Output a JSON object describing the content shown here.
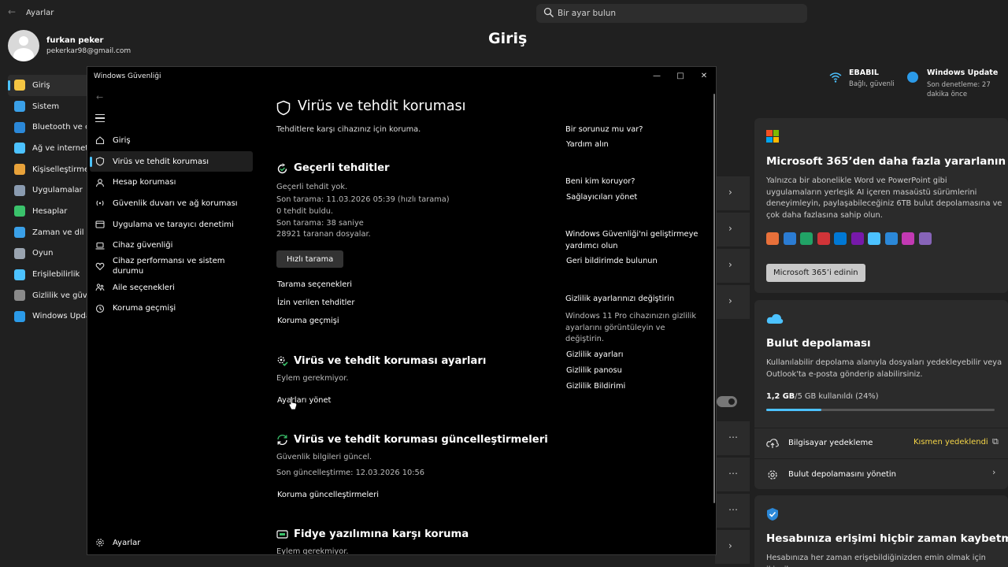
{
  "settings": {
    "app_title": "Ayarlar",
    "search_placeholder": "Bir ayar bulun",
    "user": {
      "name": "furkan peker",
      "email": "pekerkar98@gmail.com"
    },
    "page_title": "Giriş",
    "nav": [
      {
        "label": "Giriş",
        "icon": "home-icon",
        "color": "#f5c542"
      },
      {
        "label": "Sistem",
        "icon": "monitor-icon",
        "color": "#3aa0e8"
      },
      {
        "label": "Bluetooth ve cihazlar",
        "icon": "bluetooth-icon",
        "color": "#2b88d8"
      },
      {
        "label": "Ağ ve internet",
        "icon": "wifi-icon",
        "color": "#4cc2ff"
      },
      {
        "label": "Kişiselleştirme",
        "icon": "brush-icon",
        "color": "#e8a23a"
      },
      {
        "label": "Uygulamalar",
        "icon": "apps-icon",
        "color": "#8a9bb0"
      },
      {
        "label": "Hesaplar",
        "icon": "person-icon",
        "color": "#3ac26b"
      },
      {
        "label": "Zaman ve dil",
        "icon": "globe-clock-icon",
        "color": "#3aa0e8"
      },
      {
        "label": "Oyun",
        "icon": "gamepad-icon",
        "color": "#9aa4b0"
      },
      {
        "label": "Erişilebilirlik",
        "icon": "accessibility-icon",
        "color": "#4cc2ff"
      },
      {
        "label": "Gizlilik ve güvenlik",
        "icon": "shield-icon",
        "color": "#8a8a8a"
      },
      {
        "label": "Windows Update",
        "icon": "update-icon",
        "color": "#2b9ae8"
      }
    ],
    "status": {
      "wifi_title": "EBABIL",
      "wifi_sub": "Bağlı, güvenli",
      "wu_title": "Windows Update",
      "wu_sub": "Son denetleme: 27 dakika önce"
    },
    "cards": {
      "ms365": {
        "title": "Microsoft 365’den daha fazla yararlanın",
        "text": "Yalnızca bir abonelikle Word ve PowerPoint gibi uygulamaların yerleşik AI içeren masaüstü sürümlerini deneyimleyin, paylaşabileceğiniz 6TB bulut depolamasına ve çok daha fazlasına sahip olun.",
        "button": "Microsoft 365’i edinin",
        "app_colors": [
          "#e8703a",
          "#2b7cd3",
          "#21a366",
          "#d13438",
          "#0078d4",
          "#7719aa",
          "#4cc2ff",
          "#2b88d8",
          "#c239b3",
          "#8764b8"
        ]
      },
      "cloud": {
        "title": "Bulut depolaması",
        "text": "Kullanılabilir depolama alanıyla dosyaları yedekleyebilir veya Outlook'ta e-posta gönderip alabilirsiniz.",
        "usage_strong": "1,2 GB",
        "usage_rest": "/5 GB kullanıldı (24%)",
        "usage_fraction": 0.24,
        "backup_label": "Bilgisayar yedekleme",
        "backup_status": "Kısmen yedeklendi",
        "manage_label": "Bulut depolamasını yönetin"
      },
      "account": {
        "title": "Hesabınıza erişimi hiçbir zaman kaybetmeyin",
        "text": "Hesabınıza her zaman erişebildiğinizden emin olmak için ikincil"
      }
    }
  },
  "security": {
    "window_title": "Windows Güvenliği",
    "nav": [
      {
        "label": "Giriş",
        "icon": "home-icon"
      },
      {
        "label": "Virüs ve tehdit koruması",
        "icon": "shield-icon",
        "active": true
      },
      {
        "label": "Hesap koruması",
        "icon": "person-icon"
      },
      {
        "label": "Güvenlik duvarı ve ağ koruması",
        "icon": "antenna-icon"
      },
      {
        "label": "Uygulama ve tarayıcı denetimi",
        "icon": "browser-icon"
      },
      {
        "label": "Cihaz güvenliği",
        "icon": "laptop-icon"
      },
      {
        "label": "Cihaz performansı ve sistem durumu",
        "icon": "heart-icon"
      },
      {
        "label": "Aile seçenekleri",
        "icon": "family-icon"
      },
      {
        "label": "Koruma geçmişi",
        "icon": "history-icon"
      }
    ],
    "settings_label": "Ayarlar",
    "page_title": "Virüs ve tehdit koruması",
    "page_subtitle": "Tehditlere karşı cihazınız için koruma.",
    "current_threats": {
      "title": "Geçerli tehditler",
      "lines": [
        "Geçerli tehdit yok.",
        "Son tarama: 11.03.2026 05:39 (hızlı tarama)",
        "0 tehdit buldu.",
        "Son tarama: 38 saniye",
        "28921 taranan dosyalar."
      ],
      "scan_button": "Hızlı tarama",
      "links": [
        "Tarama seçenekleri",
        "İzin verilen tehditler",
        "Koruma geçmişi"
      ]
    },
    "protection_settings": {
      "title": "Virüs ve tehdit koruması ayarları",
      "status": "Eylem gerekmiyor.",
      "link": "Ayarları yönet"
    },
    "updates": {
      "title": "Virüs ve tehdit koruması güncelleştirmeleri",
      "line1": "Güvenlik bilgileri güncel.",
      "line2": "Son güncelleştirme: 12.03.2026 10:56",
      "link": "Koruma güncelleştirmeleri"
    },
    "ransomware": {
      "title": "Fidye yazılımına karşı koruma",
      "status": "Eylem gerekmiyor."
    },
    "sidebar": {
      "question_title": "Bir sorunuz mu var?",
      "help_link": "Yardım alın",
      "who_title": "Beni kim koruyor?",
      "providers_link": "Sağlayıcıları yönet",
      "improve_title": "Windows Güvenliği'ni geliştirmeye yardımcı olun",
      "feedback_link": "Geri bildirimde bulunun",
      "privacy_title": "Gizlilik ayarlarınızı değiştirin",
      "privacy_text": "Windows 11 Pro cihazınızın gizlilik ayarlarını görüntüleyin ve değiştirin.",
      "privacy_links": [
        "Gizlilik ayarları",
        "Gizlilik panosu",
        "Gizlilik Bildirimi"
      ]
    }
  }
}
